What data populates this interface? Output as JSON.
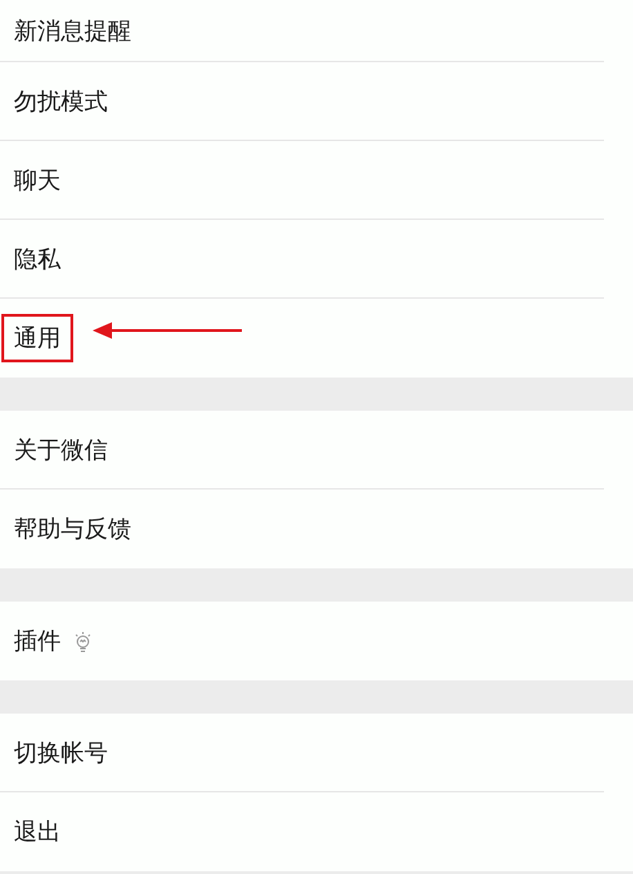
{
  "groups": [
    {
      "items": [
        {
          "label": "新消息提醒",
          "highlighted": false
        },
        {
          "label": "勿扰模式",
          "highlighted": false
        },
        {
          "label": "聊天",
          "highlighted": false
        },
        {
          "label": "隐私",
          "highlighted": false
        },
        {
          "label": "通用",
          "highlighted": true
        }
      ]
    },
    {
      "items": [
        {
          "label": "关于微信",
          "highlighted": false
        },
        {
          "label": "帮助与反馈",
          "highlighted": false
        }
      ]
    },
    {
      "items": [
        {
          "label": "插件",
          "highlighted": false,
          "kind": "bulb"
        }
      ]
    },
    {
      "items": [
        {
          "label": "切换帐号",
          "highlighted": false
        },
        {
          "label": "退出",
          "highlighted": false
        }
      ]
    }
  ]
}
